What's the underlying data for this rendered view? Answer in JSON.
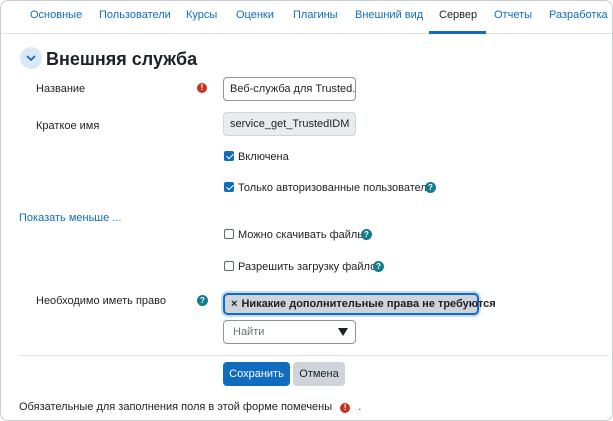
{
  "tabs": [
    {
      "label": "Основные"
    },
    {
      "label": "Пользователи"
    },
    {
      "label": "Курсы"
    },
    {
      "label": "Оценки"
    },
    {
      "label": "Плагины"
    },
    {
      "label": "Внешний вид"
    },
    {
      "label": "Сервер",
      "active": true
    },
    {
      "label": "Отчеты"
    },
    {
      "label": "Разработка"
    }
  ],
  "section": {
    "title": "Внешняя служба"
  },
  "form": {
    "name_label": "Название",
    "name_value": "Веб-служба для Trusted.I",
    "shortname_label": "Краткое имя",
    "shortname_value": "service_get_TrustedIDM",
    "enabled_label": "Включена",
    "restricted_label": "Только авторизованные пользователи",
    "show_less_link": "Показать меньше ...",
    "downloadfiles_label": "Можно скачивать файлы",
    "uploadfiles_label": "Разрешить загрузку файлов",
    "capability_label": "Необходимо иметь право",
    "capability_chip": "Никакие дополнительные права не требуются",
    "chip_remove": "×",
    "search_placeholder": "Найти",
    "save_button": "Сохранить",
    "cancel_button": "Отмена",
    "required_note": "Обязательные для заполнения поля в этой форме помечены",
    "required_note_end": "."
  },
  "icons": {
    "required": "!",
    "help": "?"
  },
  "colors": {
    "link": "#0f6cbf",
    "required": "#ca3120",
    "help": "#137d8f"
  }
}
